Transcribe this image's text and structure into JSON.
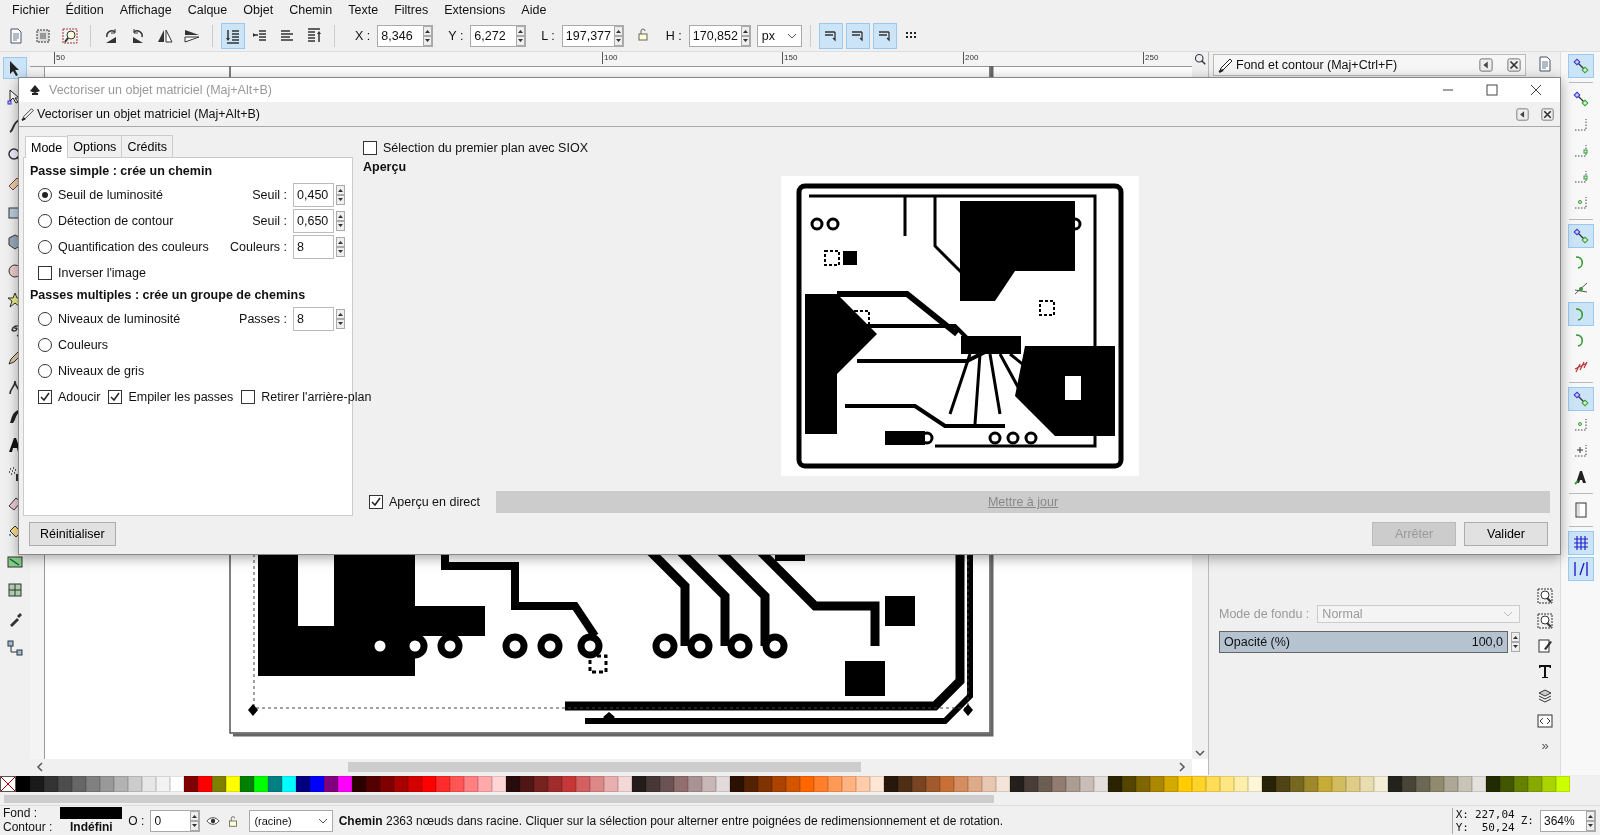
{
  "menu": [
    "Fichier",
    "Édition",
    "Affichage",
    "Calque",
    "Objet",
    "Chemin",
    "Texte",
    "Filtres",
    "Extensions",
    "Aide"
  ],
  "toolbar": {
    "buttons": [
      {
        "on": false
      },
      {
        "on": false
      },
      {
        "on": false
      },
      {
        "on": false
      },
      {
        "on": false
      },
      {
        "on": false
      },
      {
        "on": false
      },
      {
        "on": true
      },
      {
        "on": false
      },
      {
        "on": false
      },
      {
        "on": false
      }
    ],
    "fields": [
      {
        "label": "X :",
        "value": "8,346"
      },
      {
        "label": "Y :",
        "value": "6,272"
      },
      {
        "label": "L :",
        "value": "197,377"
      },
      {
        "label": "H :",
        "value": "170,852"
      }
    ],
    "unit": "px",
    "options": [
      {
        "on": true
      },
      {
        "on": true
      },
      {
        "on": true
      },
      {
        "on": false
      }
    ]
  },
  "tools": [
    {
      "selected": true
    },
    {
      "selected": false
    },
    {
      "selected": false
    },
    {
      "selected": false
    },
    {
      "selected": false
    },
    {
      "selected": false
    },
    {
      "selected": false
    },
    {
      "selected": false
    },
    {
      "selected": false
    },
    {
      "selected": false
    },
    {
      "selected": false
    },
    {
      "selected": false
    },
    {
      "selected": false
    },
    {
      "selected": false
    },
    {
      "selected": false
    },
    {
      "selected": false
    },
    {
      "selected": false
    },
    {
      "selected": false
    },
    {
      "selected": false
    },
    {
      "selected": false
    },
    {
      "selected": false
    }
  ],
  "ruler_labels": [
    "50",
    "100",
    "150",
    "200",
    "250"
  ],
  "dock": {
    "title": "Fond et contour (Maj+Ctrl+F)",
    "blend_label": "Mode de fondu :",
    "blend_value": "Normal",
    "opacity": {
      "label": "Opacité (%)",
      "value": "100,0",
      "level": 1
    }
  },
  "snap": [
    {
      "on": true
    },
    {
      "on": false
    },
    {
      "on": false
    },
    {
      "on": false
    },
    {
      "on": false
    },
    {
      "on": false
    },
    {
      "on": true
    },
    {
      "on": false
    },
    {
      "on": false
    },
    {
      "on": true
    },
    {
      "on": false
    },
    {
      "on": false
    },
    {
      "on": true
    },
    {
      "on": false
    },
    {
      "on": false
    },
    {
      "on": false
    },
    {
      "on": false
    },
    {
      "on": true
    },
    {
      "on": true
    }
  ],
  "commands_more": "»",
  "dialog": {
    "title": "Vectoriser un objet matriciel (Maj+Alt+B)",
    "header": "Vectoriser un objet matriciel (Maj+Alt+B)",
    "tabs": [
      {
        "label": "Mode",
        "selected": true
      },
      {
        "label": "Options",
        "selected": false
      },
      {
        "label": "Crédits",
        "selected": false
      }
    ],
    "sections": [
      {
        "title": "Passe simple : crée un chemin",
        "rows": [
          {
            "kind": "radio",
            "label": "Seuil de luminosité",
            "selected": true,
            "spin_label": "Seuil :",
            "spin_value": "0,450"
          },
          {
            "kind": "radio",
            "label": "Détection de contour",
            "selected": false,
            "spin_label": "Seuil :",
            "spin_value": "0,650"
          },
          {
            "kind": "radio",
            "label": "Quantification des couleurs",
            "selected": false,
            "spin_label": "Couleurs :",
            "spin_value": "8"
          },
          {
            "kind": "checks",
            "items": [
              {
                "label": "Inverser l'image",
                "checked": false
              }
            ]
          }
        ]
      },
      {
        "title": "Passes multiples : crée un groupe de chemins",
        "rows": [
          {
            "kind": "radio",
            "label": "Niveaux de luminosité",
            "selected": false,
            "spin_label": "Passes :",
            "spin_value": "8"
          },
          {
            "kind": "radio",
            "label": "Couleurs",
            "selected": false
          },
          {
            "kind": "radio",
            "label": "Niveaux de gris",
            "selected": false
          },
          {
            "kind": "checks",
            "items": [
              {
                "label": "Adoucir",
                "checked": true
              },
              {
                "label": "Empiler les passes",
                "checked": true
              },
              {
                "label": "Retirer l'arrière-plan",
                "checked": false
              }
            ]
          }
        ]
      }
    ],
    "siox": {
      "label": "Sélection du premier plan avec SIOX",
      "checked": false
    },
    "preview_label": "Aperçu",
    "live_preview": {
      "label": "Aperçu en direct",
      "checked": true
    },
    "update_button": {
      "label": "Mettre à jour",
      "disabled": true
    },
    "reset_button": {
      "label": "Réinitialiser",
      "disabled": false
    },
    "stop_button": {
      "label": "Arrêter",
      "disabled": true
    },
    "ok_button": {
      "label": "Valider",
      "disabled": false
    }
  },
  "palette": [
    {
      "color": "#000000"
    },
    {
      "color": "#1a1a1a"
    },
    {
      "color": "#333333"
    },
    {
      "color": "#4d4d4d"
    },
    {
      "color": "#666666"
    },
    {
      "color": "#808080"
    },
    {
      "color": "#999999"
    },
    {
      "color": "#b3b3b3"
    },
    {
      "color": "#cccccc"
    },
    {
      "color": "#e6e6e6"
    },
    {
      "color": "#f2f2f2"
    },
    {
      "color": "#ffffff"
    },
    {
      "color": "#800000"
    },
    {
      "color": "#ff0000"
    },
    {
      "color": "#808000"
    },
    {
      "color": "#ffff00"
    },
    {
      "color": "#008000"
    },
    {
      "color": "#00ff00"
    },
    {
      "color": "#008080"
    },
    {
      "color": "#00ffff"
    },
    {
      "color": "#000080"
    },
    {
      "color": "#0000ff"
    },
    {
      "color": "#800080"
    },
    {
      "color": "#ff00ff"
    },
    {
      "color": "#2b0000"
    },
    {
      "color": "#550000"
    },
    {
      "color": "#800001"
    },
    {
      "color": "#aa0000"
    },
    {
      "color": "#d40000"
    },
    {
      "color": "#ff0001"
    },
    {
      "color": "#ff2a2a"
    },
    {
      "color": "#ff5555"
    },
    {
      "color": "#ff8080"
    },
    {
      "color": "#ffaaaa"
    },
    {
      "color": "#ffd5d5"
    },
    {
      "color": "#280b0b"
    },
    {
      "color": "#501616"
    },
    {
      "color": "#782121"
    },
    {
      "color": "#a02c2c"
    },
    {
      "color": "#c83737"
    },
    {
      "color": "#d35f5f"
    },
    {
      "color": "#de8787"
    },
    {
      "color": "#e9afaf"
    },
    {
      "color": "#f4d7d7"
    },
    {
      "color": "#241c1c"
    },
    {
      "color": "#483737"
    },
    {
      "color": "#6c5353"
    },
    {
      "color": "#916f6f"
    },
    {
      "color": "#ac9393"
    },
    {
      "color": "#c8b7b7"
    },
    {
      "color": "#e3dbdb"
    },
    {
      "color": "#2b1100"
    },
    {
      "color": "#552200"
    },
    {
      "color": "#803300"
    },
    {
      "color": "#aa4400"
    },
    {
      "color": "#d45500"
    },
    {
      "color": "#ff6600"
    },
    {
      "color": "#ff7f2a"
    },
    {
      "color": "#ff9955"
    },
    {
      "color": "#ffb380"
    },
    {
      "color": "#ffccaa"
    },
    {
      "color": "#ffe6d5"
    },
    {
      "color": "#28170b"
    },
    {
      "color": "#502d16"
    },
    {
      "color": "#784421"
    },
    {
      "color": "#a05a2c"
    },
    {
      "color": "#c87137"
    },
    {
      "color": "#d38d5f"
    },
    {
      "color": "#deaa87"
    },
    {
      "color": "#e9c6af"
    },
    {
      "color": "#f4e3d7"
    },
    {
      "color": "#241f1c"
    },
    {
      "color": "#483e37"
    },
    {
      "color": "#6c5d53"
    },
    {
      "color": "#917c6f"
    },
    {
      "color": "#ac9d93"
    },
    {
      "color": "#c8beb7"
    },
    {
      "color": "#e3dedb"
    },
    {
      "color": "#2b2200"
    },
    {
      "color": "#554400"
    },
    {
      "color": "#806600"
    },
    {
      "color": "#aa8800"
    },
    {
      "color": "#d4aa00"
    },
    {
      "color": "#ffcc00"
    },
    {
      "color": "#ffd42a"
    },
    {
      "color": "#ffdd55"
    },
    {
      "color": "#ffe680"
    },
    {
      "color": "#ffeeaa"
    },
    {
      "color": "#fff6d5"
    },
    {
      "color": "#28220b"
    },
    {
      "color": "#504416"
    },
    {
      "color": "#786721"
    },
    {
      "color": "#a0892c"
    },
    {
      "color": "#c8ab37"
    },
    {
      "color": "#d3bc5f"
    },
    {
      "color": "#decd87"
    },
    {
      "color": "#e9ddaf"
    },
    {
      "color": "#f4eed7"
    },
    {
      "color": "#24221c"
    },
    {
      "color": "#484537"
    },
    {
      "color": "#6c6753"
    },
    {
      "color": "#918a6f"
    },
    {
      "color": "#aca793"
    },
    {
      "color": "#c8c4b7"
    },
    {
      "color": "#e3e2db"
    },
    {
      "color": "#222b00"
    },
    {
      "color": "#445500"
    },
    {
      "color": "#668000"
    },
    {
      "color": "#88aa00"
    },
    {
      "color": "#aad400"
    },
    {
      "color": "#ccff00"
    }
  ],
  "status": {
    "fill_label": "Fond :",
    "stroke_label": "Contour :",
    "stroke_value": "Indéfini",
    "opacity_label": "O :",
    "opacity_value": "0",
    "layer": "(racine)",
    "message": "**Chemin** 2363 nœuds dans racine. Cliquer sur la sélection pour alterner entre poignées de redimensionnement et de rotation.",
    "x_label": "X:",
    "x_value": "227,04",
    "y_label": "Y:",
    "y_value": "50,24",
    "zoom_label": "Z:",
    "zoom_value": "364%"
  }
}
